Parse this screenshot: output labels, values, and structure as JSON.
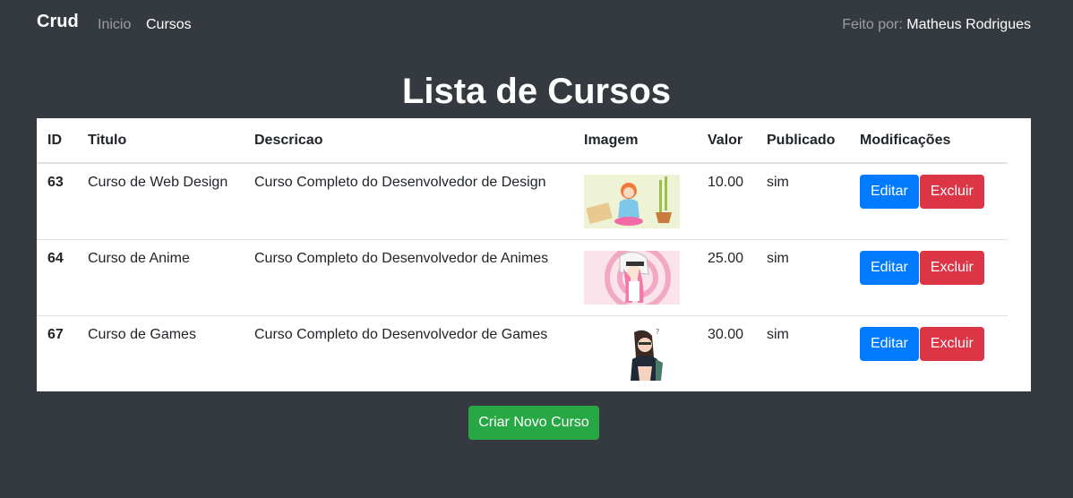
{
  "navbar": {
    "brand": "Crud",
    "links": [
      {
        "label": "Inicio",
        "active": false
      },
      {
        "label": "Cursos",
        "active": true
      }
    ],
    "credit_label": "Feito por:",
    "credit_name": "Matheus Rodrigues"
  },
  "page": {
    "title": "Lista de Cursos"
  },
  "table": {
    "headers": [
      "ID",
      "Titulo",
      "Descricao",
      "Imagem",
      "Valor",
      "Publicado",
      "Modificações"
    ],
    "rows": [
      {
        "id": "63",
        "titulo": "Curso de Web Design",
        "descricao": "Curso Completo do Desenvolvedor de Design",
        "image": "web-design-illustration",
        "valor": "10.00",
        "publicado": "sim",
        "edit": "Editar",
        "delete": "Excluir"
      },
      {
        "id": "64",
        "titulo": "Curso de Anime",
        "descricao": "Curso Completo do Desenvolvedor de Animes",
        "image": "anime-illustration",
        "valor": "25.00",
        "publicado": "sim",
        "edit": "Editar",
        "delete": "Excluir"
      },
      {
        "id": "67",
        "titulo": "Curso de Games",
        "descricao": "Curso Completo do Desenvolvedor de Games",
        "image": "games-illustration",
        "valor": "30.00",
        "publicado": "sim",
        "edit": "Editar",
        "delete": "Excluir"
      }
    ]
  },
  "actions": {
    "create_label": "Criar Novo Curso"
  },
  "colors": {
    "background": "#343a40",
    "primary": "#007bff",
    "danger": "#dc3545",
    "success": "#28a745"
  }
}
